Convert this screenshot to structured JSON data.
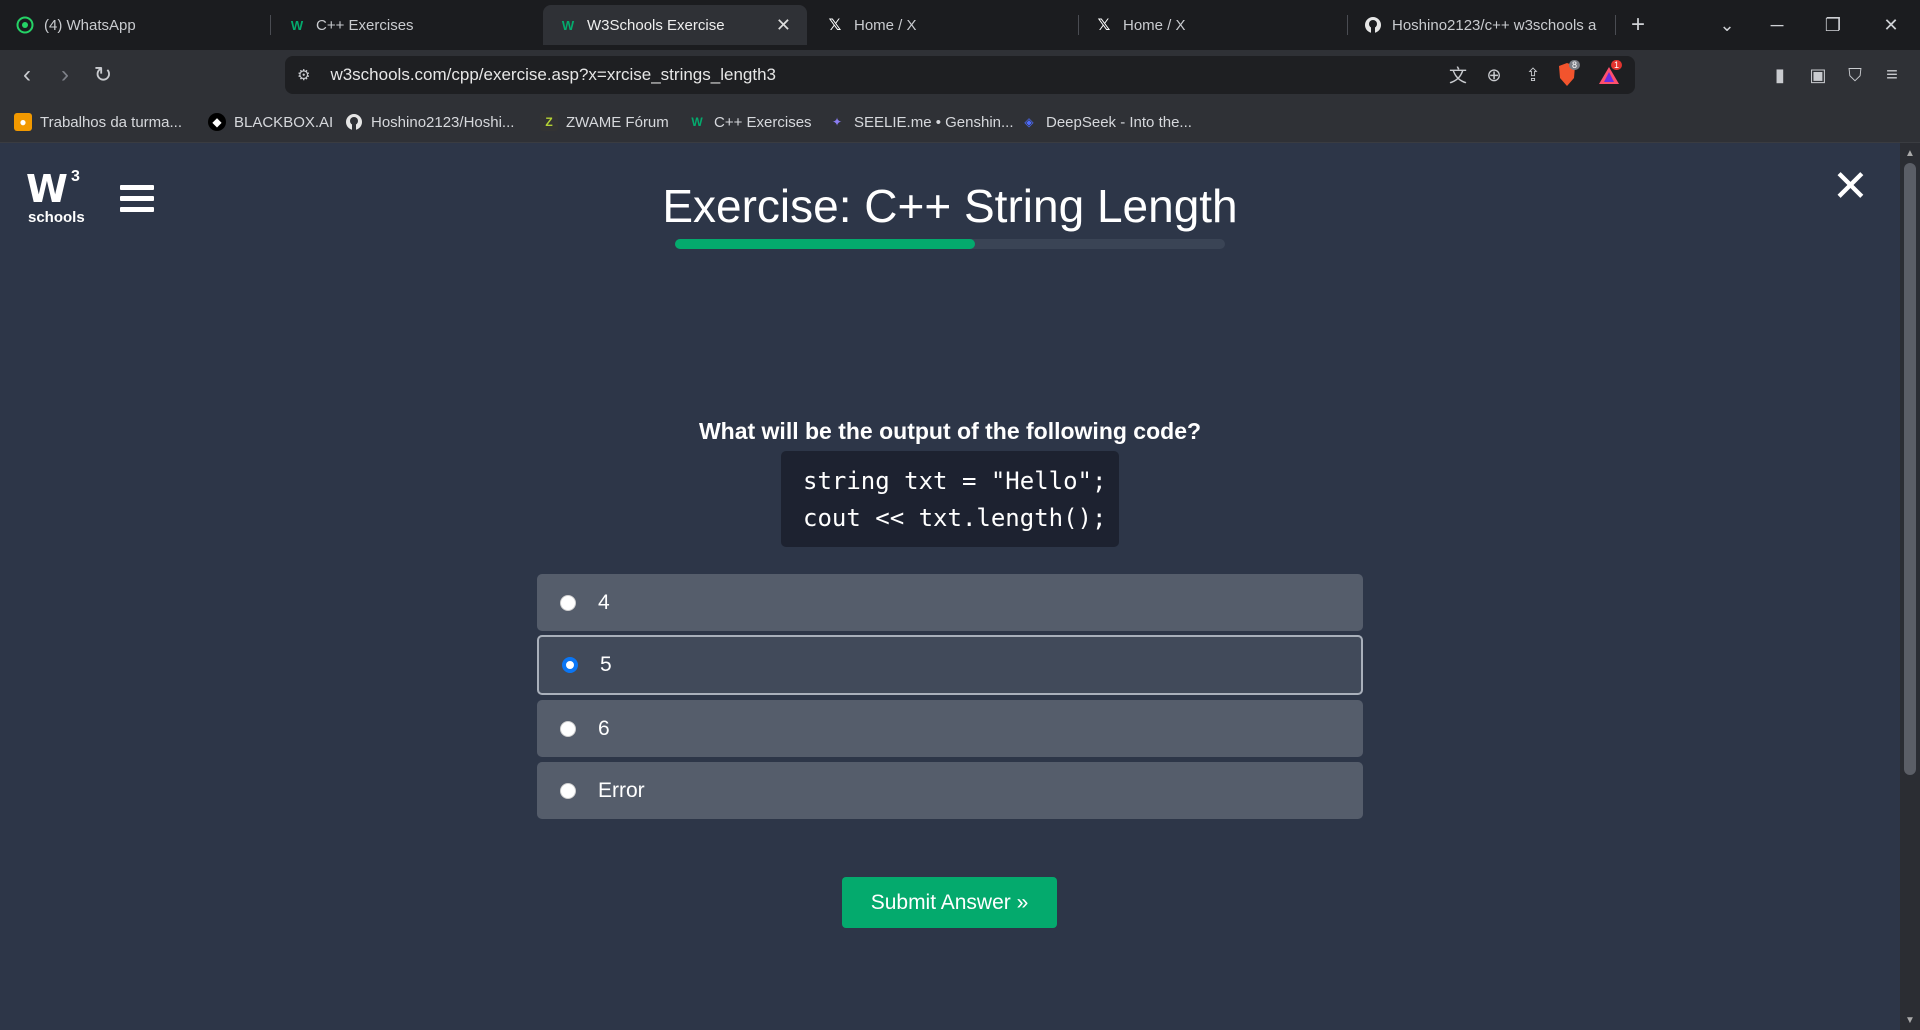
{
  "browser": {
    "tabs": [
      {
        "title": "(4) WhatsApp",
        "icon": "whatsapp-icon",
        "active": false
      },
      {
        "title": "C++ Exercises",
        "icon": "w3schools-icon",
        "active": false
      },
      {
        "title": "W3Schools Exercise",
        "icon": "w3schools-icon",
        "active": true
      },
      {
        "title": "Home / X",
        "icon": "x-icon",
        "active": false
      },
      {
        "title": "Home / X",
        "icon": "x-icon",
        "active": false
      },
      {
        "title": "Hoshino2123/c++ w3schools a",
        "icon": "github-icon",
        "active": false
      }
    ],
    "new_tab": "+",
    "url": "w3schools.com/cpp/exercise.asp?x=xrcise_strings_length3",
    "brave_shield_count": "8",
    "rewards_count": "1",
    "bookmarks": [
      {
        "label": "Trabalhos da turma...",
        "icon": "classroom-icon"
      },
      {
        "label": "BLACKBOX.AI",
        "icon": "blackbox-icon"
      },
      {
        "label": "Hoshino2123/Hoshi...",
        "icon": "github-icon"
      },
      {
        "label": "ZWAME Fórum",
        "icon": "zwame-icon"
      },
      {
        "label": "C++ Exercises",
        "icon": "w3schools-icon"
      },
      {
        "label": "SEELIE.me • Genshin...",
        "icon": "seelie-icon"
      },
      {
        "label": "DeepSeek - Into the...",
        "icon": "deepseek-icon"
      }
    ]
  },
  "header": {
    "logo_mark": "W",
    "logo_superscript": "3",
    "logo_text": "schools",
    "title": "Exercise: C++ String Length",
    "progress_fraction": 0.545
  },
  "quiz": {
    "question": "What will be the output of the following code?",
    "code_lines": [
      "string txt = \"Hello\";",
      "cout << txt.length();"
    ],
    "options": [
      {
        "label": "4",
        "selected": false
      },
      {
        "label": "5",
        "selected": true
      },
      {
        "label": "6",
        "selected": false
      },
      {
        "label": "Error",
        "selected": false
      }
    ],
    "submit_label": "Submit Answer »"
  },
  "colors": {
    "accent": "#04aa6d",
    "page_background": "#2d3648",
    "option_background": "#555d6b",
    "radio_checked": "#0a76f5"
  }
}
